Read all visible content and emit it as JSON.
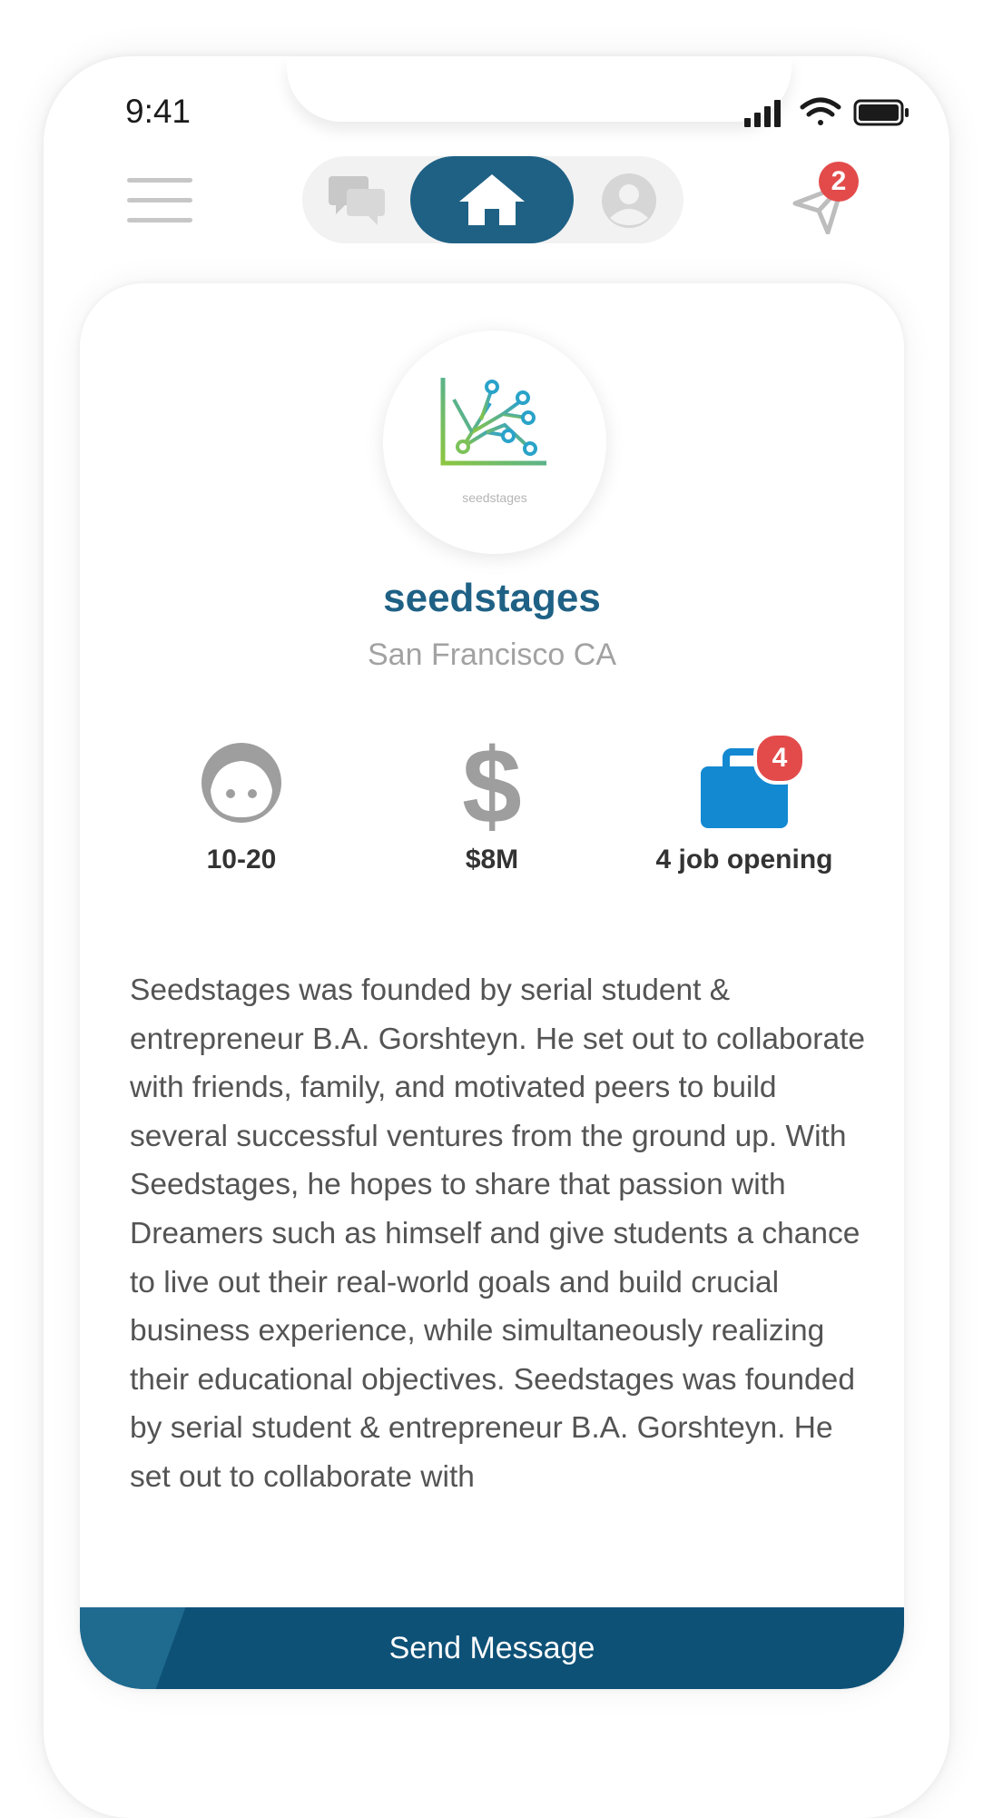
{
  "status_bar": {
    "time": "9:41"
  },
  "nav": {
    "notification_count": "2",
    "active_tab": "home",
    "colors": {
      "active": "#1f6185",
      "inactive": "#c4c4c4",
      "pill": "#f2f2f2"
    }
  },
  "company": {
    "logo_text": "seedstages",
    "name": "seedstages",
    "location": "San Francisco CA",
    "stats": {
      "employees": "10-20",
      "funding": "$8M",
      "jobs_badge": "4",
      "jobs_label": "4 job opening"
    },
    "description": "Seedstages was founded by serial student & entrepreneur B.A. Gorshteyn. He set out to collaborate with friends, family, and motivated peers to build several successful ventures from the ground up. With Seedstages, he hopes to share that passion with Dreamers such as himself and give students a chance to live out their real-world goals and build crucial business experience, while simultaneously realizing their educational objectives. Seedstages was founded by serial student & entrepreneur B.A. Gorshteyn. He set out to collaborate with"
  },
  "actions": {
    "send_message": "Send Message"
  },
  "icons": {
    "menu": "hamburger-menu-icon",
    "chat": "chat-bubbles-icon",
    "home": "home-icon",
    "profile": "user-circle-icon",
    "notifications": "paper-plane-icon",
    "employees": "face-icon",
    "funding": "dollar-icon",
    "jobs": "briefcase-icon"
  },
  "colors": {
    "brand": "#1f6185",
    "button": "#0e5177",
    "badge": "#e34b4b",
    "jobs_icon": "#1389d2"
  }
}
